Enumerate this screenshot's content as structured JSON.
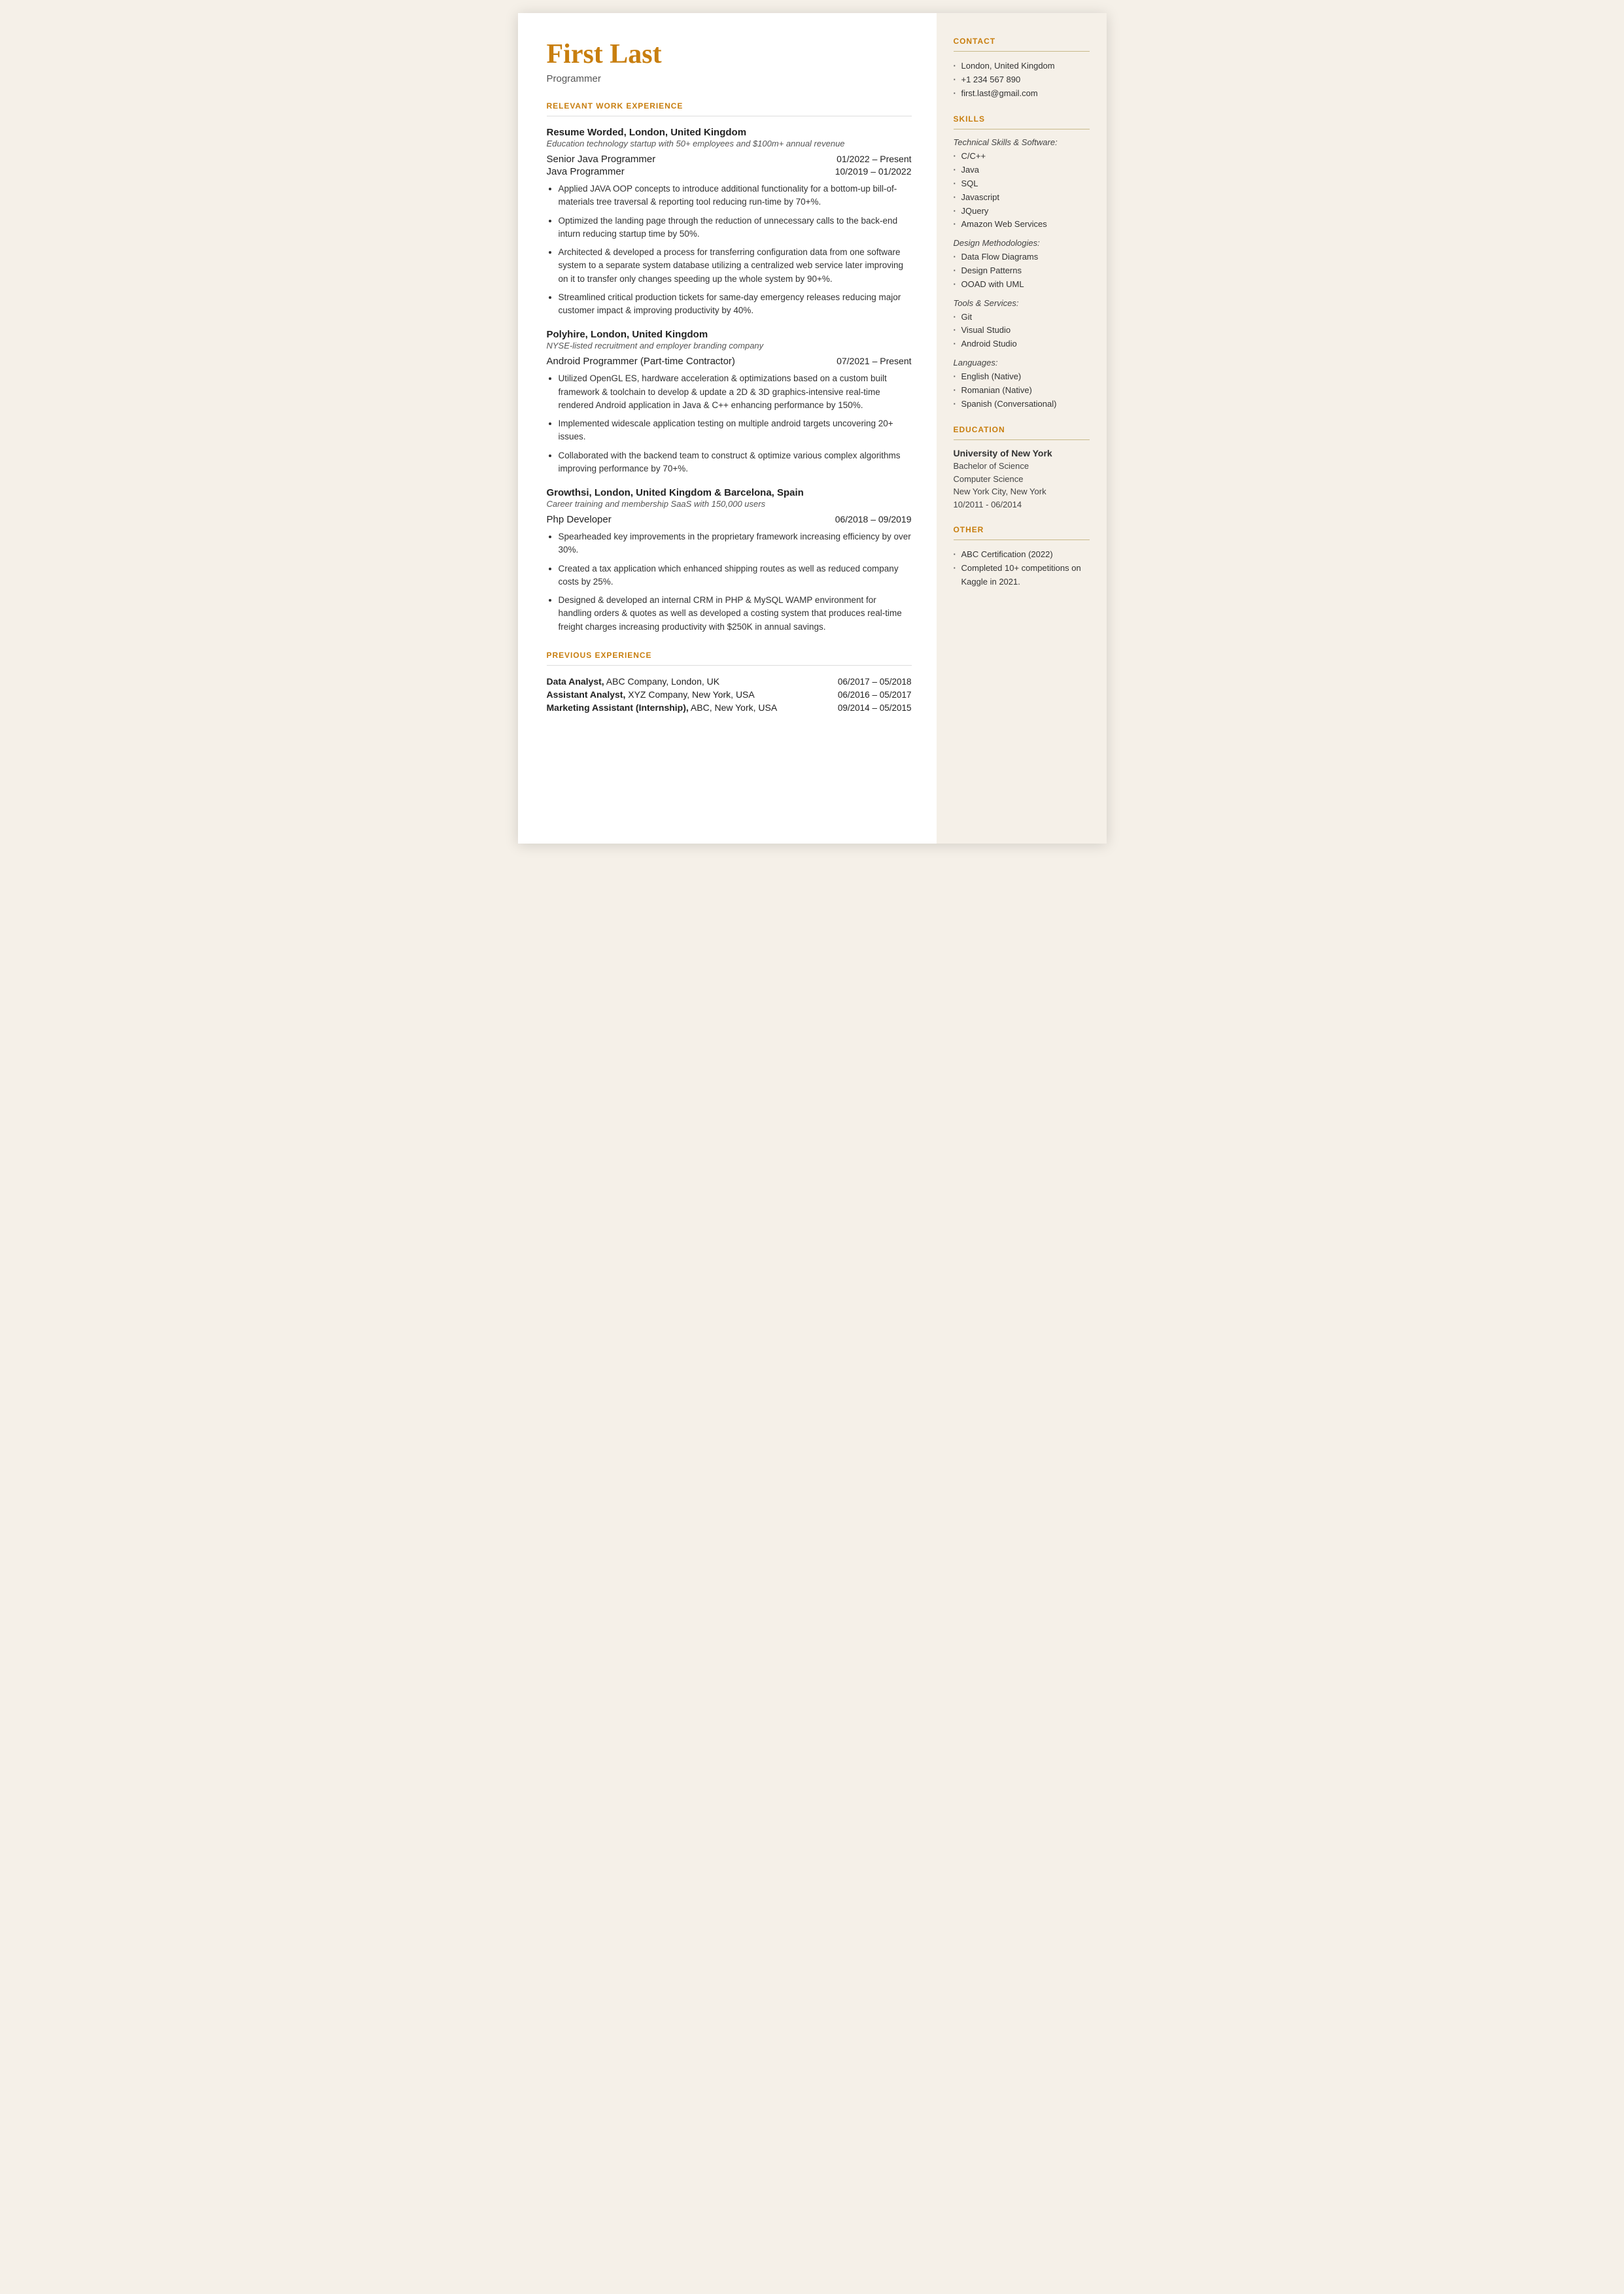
{
  "header": {
    "name": "First Last",
    "title": "Programmer"
  },
  "sections": {
    "relevant_work": "RELEVANT WORK EXPERIENCE",
    "previous_exp": "PREVIOUS EXPERIENCE"
  },
  "jobs": [
    {
      "company": "Resume Worded,",
      "company_rest": " London, United Kingdom",
      "description": "Education technology startup with 50+ employees and $100m+ annual revenue",
      "roles": [
        {
          "title": "Senior Java Programmer",
          "dates": "01/2022 – Present"
        },
        {
          "title": "Java Programmer",
          "dates": "10/2019 – 01/2022"
        }
      ],
      "bullets": [
        "Applied JAVA OOP concepts to introduce additional functionality for a bottom-up bill-of-materials tree traversal & reporting tool reducing run-time by 70+%.",
        "Optimized the landing page through the reduction of unnecessary calls to the back-end inturn reducing startup time by 50%.",
        "Architected & developed a process for transferring configuration data from one software system to a separate system database utilizing a centralized web service later improving on it to transfer only changes speeding up the whole system by 90+%.",
        "Streamlined critical production tickets for same-day emergency releases reducing major customer impact & improving productivity by 40%."
      ]
    },
    {
      "company": "Polyhire,",
      "company_rest": " London, United Kingdom",
      "description": "NYSE-listed recruitment and employer branding company",
      "roles": [
        {
          "title": "Android Programmer (Part-time Contractor)",
          "dates": "07/2021 – Present"
        }
      ],
      "bullets": [
        "Utilized OpenGL ES, hardware acceleration & optimizations based on a custom built framework & toolchain to develop & update a 2D & 3D graphics-intensive real-time rendered Android application in Java & C++ enhancing performance by 150%.",
        "Implemented widescale application testing on multiple android targets uncovering 20+ issues.",
        "Collaborated with the backend team to construct & optimize various complex algorithms improving performance by 70+%."
      ]
    },
    {
      "company": "Growthsi,",
      "company_rest": " London, United Kingdom & Barcelona, Spain",
      "description": "Career training and membership SaaS with 150,000 users",
      "roles": [
        {
          "title": "Php Developer",
          "dates": "06/2018 – 09/2019"
        }
      ],
      "bullets": [
        "Spearheaded key improvements in the proprietary framework increasing efficiency by over 30%.",
        "Created a tax application which enhanced shipping routes as well as reduced company costs by 25%.",
        "Designed & developed an internal CRM in PHP & MySQL WAMP environment for handling orders & quotes as well as developed a costing system that produces real-time freight charges increasing productivity with $250K in annual savings."
      ]
    }
  ],
  "previous_experience": [
    {
      "title": "Data Analyst,",
      "rest": " ABC Company, London, UK",
      "dates": "06/2017 – 05/2018"
    },
    {
      "title": "Assistant Analyst,",
      "rest": " XYZ Company, New York, USA",
      "dates": "06/2016 – 05/2017"
    },
    {
      "title": "Marketing Assistant (Internship),",
      "rest": " ABC, New York, USA",
      "dates": "09/2014 – 05/2015"
    }
  ],
  "sidebar": {
    "contact_heading": "CONTACT",
    "contact_items": [
      "London, United Kingdom",
      "+1 234 567 890",
      "first.last@gmail.com"
    ],
    "skills_heading": "SKILLS",
    "technical_label": "Technical Skills & Software:",
    "technical_items": [
      "C/C++",
      "Java",
      "SQL",
      "Javascript",
      "JQuery",
      "Amazon Web Services"
    ],
    "design_label": "Design Methodologies:",
    "design_items": [
      "Data Flow Diagrams",
      "Design Patterns",
      "OOAD with UML"
    ],
    "tools_label": "Tools & Services:",
    "tools_items": [
      "Git",
      "Visual Studio",
      "Android Studio"
    ],
    "languages_label": "Languages:",
    "languages_items": [
      "English (Native)",
      "Romanian (Native)",
      "Spanish (Conversational)"
    ],
    "education_heading": "EDUCATION",
    "edu_university": "University of New York",
    "edu_degree": "Bachelor of Science",
    "edu_field": "Computer Science",
    "edu_location": "New York City, New York",
    "edu_dates": "10/2011 - 06/2014",
    "other_heading": "OTHER",
    "other_items": [
      "ABC Certification (2022)",
      "Completed 10+ competitions on Kaggle in 2021."
    ]
  }
}
